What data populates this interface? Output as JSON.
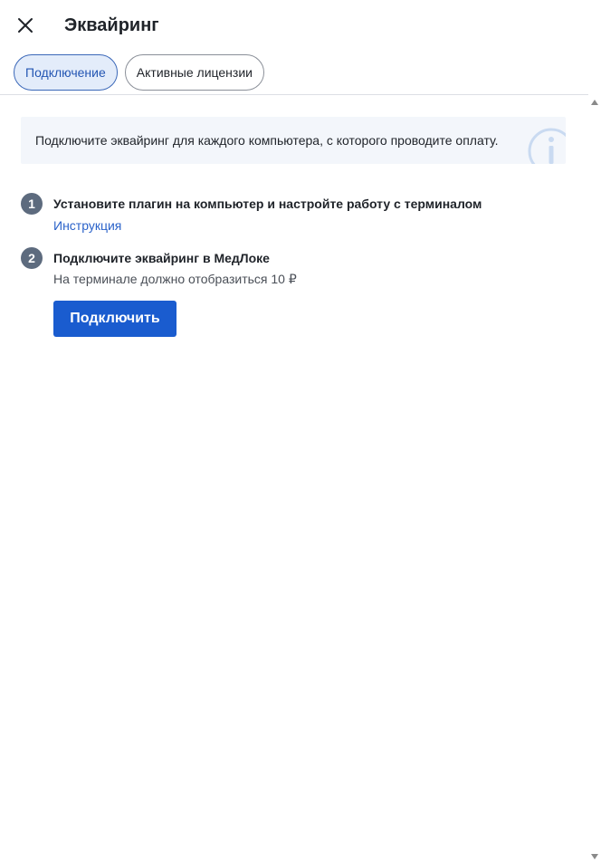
{
  "header": {
    "title": "Эквайринг",
    "close_icon": "close-icon"
  },
  "tabs": [
    {
      "label": "Подключение",
      "active": true
    },
    {
      "label": "Активные лицензии",
      "active": false
    }
  ],
  "info": {
    "text": "Подключите эквайринг для каждого компьютера, с которого проводите оплату.",
    "icon": "info-icon"
  },
  "steps": [
    {
      "number": "1",
      "title": "Установите плагин на компьютер и настройте работу с терминалом",
      "link_label": "Инструкция"
    },
    {
      "number": "2",
      "title": "Подключите эквайринг в МедЛоке",
      "subtitle": "На терминале должно отобразиться 10 ₽"
    }
  ],
  "actions": {
    "connect_label": "Подключить"
  },
  "colors": {
    "accent": "#1a5ccf",
    "tab_active_bg": "#e3ecfa",
    "info_bg": "#f3f6fb",
    "step_badge": "#5d6b7e",
    "link": "#2a62c9"
  }
}
